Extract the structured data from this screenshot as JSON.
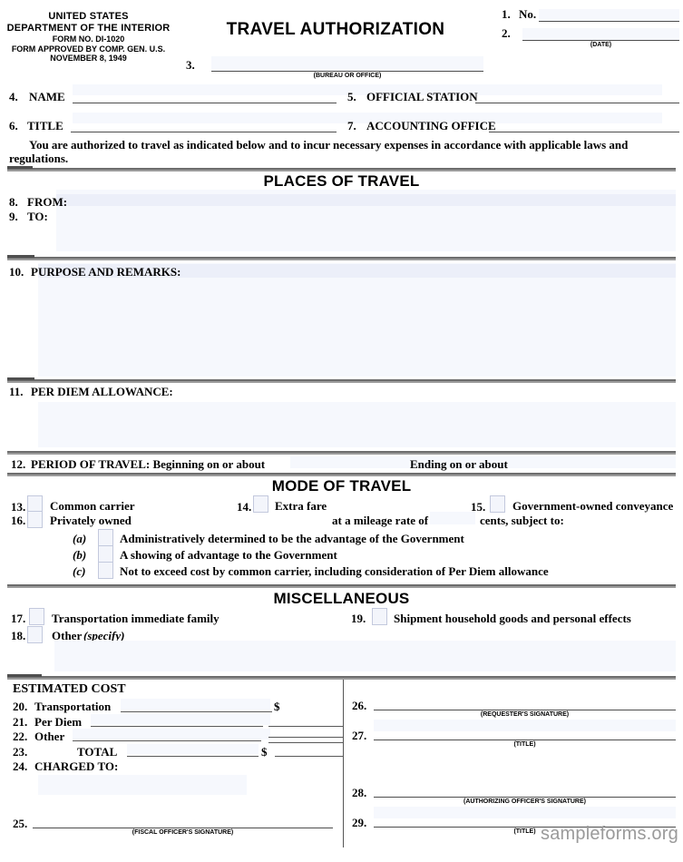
{
  "header": {
    "agency_line1": "UNITED STATES",
    "agency_line2": "DEPARTMENT  OF THE INTERIOR",
    "agency_line3": "FORM NO. DI-1020",
    "agency_line4": "FORM APPROVED BY COMP. GEN. U.S.",
    "agency_line5": "NOVEMBER 8, 1949",
    "title": "TRAVEL AUTHORIZATION",
    "field_1_num": "1.",
    "field_1_label": "No.",
    "field_1_value": "",
    "field_2_num": "2.",
    "field_2_value": "",
    "field_2_caption": "(DATE)",
    "field_3_num": "3.",
    "field_3_value": "",
    "field_3_caption": "(BUREAU OR OFFICE)"
  },
  "identity": {
    "name_num": "4.",
    "name_label": "NAME",
    "name_value": "",
    "station_num": "5.",
    "station_label": "OFFICIAL STATION",
    "station_value": "",
    "title_num": "6.",
    "title_label": "TITLE",
    "title_value": "",
    "accounting_num": "7.",
    "accounting_label": "ACCOUNTING OFFICE",
    "accounting_value": ""
  },
  "authorization_text_line1": "You are authorized to travel as indicated below and to incur necessary expenses in accordance with applicable laws and",
  "authorization_text_line2": "regulations.",
  "places_of_travel": {
    "heading": "PLACES OF TRAVEL",
    "from_num": "8.",
    "from_label": "FROM:",
    "from_value": "",
    "to_num": "9.",
    "to_label": "TO:",
    "to_value": ""
  },
  "purpose": {
    "num": "10.",
    "label": "PURPOSE AND REMARKS:",
    "value": ""
  },
  "per_diem": {
    "num": "11.",
    "label": "PER DIEM ALLOWANCE:",
    "value": ""
  },
  "period_of_travel": {
    "num": "12.",
    "label": "PERIOD OF TRAVEL: Beginning on or about",
    "begin_value": "",
    "end_label": "Ending on or about",
    "end_value": ""
  },
  "mode_of_travel": {
    "heading": "MODE OF TRAVEL",
    "items": [
      {
        "num": "13.",
        "label": "Common carrier",
        "checked": false
      },
      {
        "num": "14.",
        "label": "Extra fare",
        "checked": false
      },
      {
        "num": "15.",
        "label": "Government-owned conveyance",
        "checked": false
      },
      {
        "num": "16.",
        "label": "Privately owned",
        "checked": false
      }
    ],
    "mileage_label": "at a mileage rate of",
    "mileage_value": "",
    "cents_label": "cents, subject to:",
    "subitems": [
      {
        "letter": "(a)",
        "label": "Administratively determined to be the advantage of the Government",
        "checked": false
      },
      {
        "letter": "(b)",
        "label": "A showing of advantage to the Government",
        "checked": false
      },
      {
        "letter": "(c)",
        "label": "Not to exceed cost by common carrier, including consideration of Per Diem allowance",
        "checked": false
      }
    ]
  },
  "miscellaneous": {
    "heading": "MISCELLANEOUS",
    "items": [
      {
        "num": "17.",
        "label": "Transportation immediate family",
        "checked": false
      },
      {
        "num": "19.",
        "label": "Shipment household goods and personal effects",
        "checked": false
      },
      {
        "num": "18.",
        "label": "Other",
        "note": "(specify)",
        "checked": false
      }
    ],
    "other_value": ""
  },
  "estimated_cost": {
    "heading": "ESTIMATED COST",
    "rows": [
      {
        "num": "20.",
        "label": "Transportation",
        "symbol": "$",
        "value": "",
        "amount": ""
      },
      {
        "num": "21.",
        "label": "Per Diem",
        "symbol": "",
        "value": "",
        "amount": ""
      },
      {
        "num": "22.",
        "label": "Other",
        "symbol": "",
        "value": "",
        "amount": ""
      },
      {
        "num": "23.",
        "label": "TOTAL",
        "symbol": "$",
        "value": "",
        "amount": ""
      }
    ],
    "charged_to_num": "24.",
    "charged_to_label": "CHARGED TO:",
    "charged_to_value": "",
    "fiscal_num": "25.",
    "fiscal_value": "",
    "fiscal_caption": "(FISCAL OFFICER'S SIGNATURE)"
  },
  "signatures": [
    {
      "num": "26.",
      "value": "",
      "caption": "(REQUESTER'S SIGNATURE)"
    },
    {
      "num": "27.",
      "value": "",
      "caption": "(TITLE)"
    },
    {
      "num": "28.",
      "value": "",
      "caption": "(AUTHORIZING OFFICER'S SIGNATURE)"
    },
    {
      "num": "29.",
      "value": "",
      "caption": "(TITLE)"
    }
  ],
  "watermark": "sampleforms.org",
  "colors": {
    "rule": "#4d4d4d",
    "bar": "#8a8a8a",
    "tint": "#f6f8fd",
    "tint_strong": "#eceff9",
    "watermark": "#9a9a9a"
  }
}
